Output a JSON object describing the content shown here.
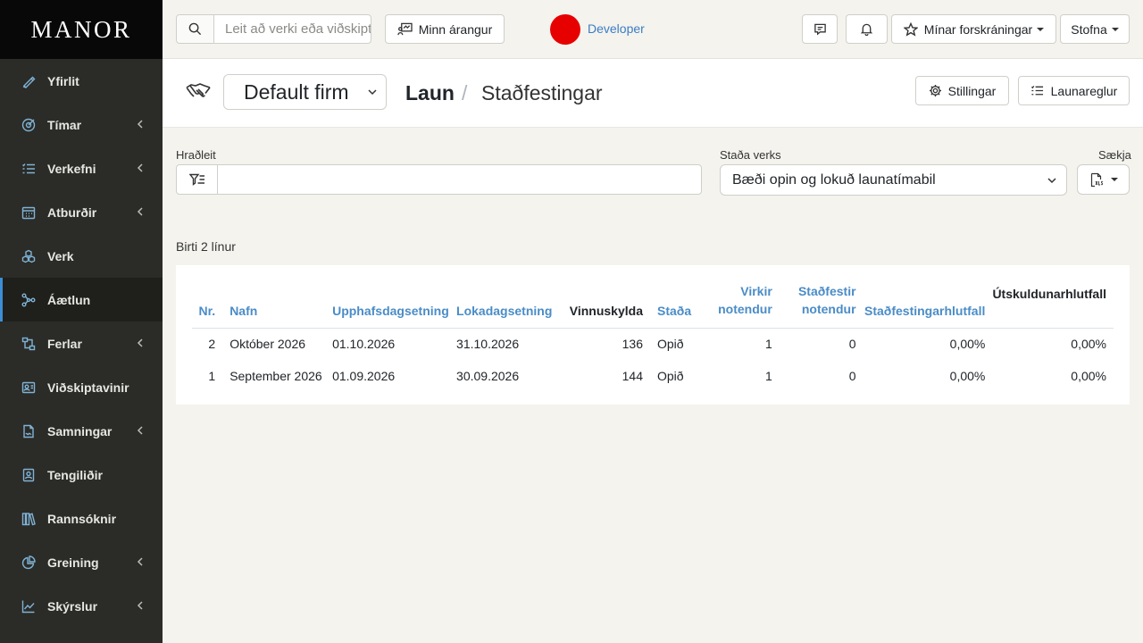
{
  "brand": "MANOR",
  "sidebar": {
    "items": [
      {
        "label": "Yfirlit",
        "icon": "pen-icon",
        "has_submenu": false
      },
      {
        "label": "Tímar",
        "icon": "target-clock-icon",
        "has_submenu": true
      },
      {
        "label": "Verkefni",
        "icon": "task-list-icon",
        "has_submenu": true
      },
      {
        "label": "Atburðir",
        "icon": "calendar-icon",
        "has_submenu": true
      },
      {
        "label": "Verk",
        "icon": "cubes-icon",
        "has_submenu": false
      },
      {
        "label": "Áætlun",
        "icon": "network-icon",
        "has_submenu": false,
        "active": true
      },
      {
        "label": "Ferlar",
        "icon": "process-icon",
        "has_submenu": true
      },
      {
        "label": "Viðskiptavinir",
        "icon": "id-card-icon",
        "has_submenu": false
      },
      {
        "label": "Samningar",
        "icon": "contract-icon",
        "has_submenu": true
      },
      {
        "label": "Tengiliðir",
        "icon": "contact-icon",
        "has_submenu": false
      },
      {
        "label": "Rannsóknir",
        "icon": "books-icon",
        "has_submenu": false
      },
      {
        "label": "Greining",
        "icon": "pie-chart-icon",
        "has_submenu": true
      },
      {
        "label": "Skýrslur",
        "icon": "line-chart-icon",
        "has_submenu": true
      }
    ]
  },
  "topbar": {
    "search_placeholder": "Leit að verki eða viðskiptavini",
    "achievements_label": "Minn árangur",
    "user_name": "Developer",
    "my_registrations_label": "Mínar forskráningar",
    "create_label": "Stofna"
  },
  "header": {
    "firm": "Default firm",
    "crumb_parent": "Laun",
    "crumb_separator": "/",
    "crumb_current": "Staðfestingar",
    "settings_label": "Stillingar",
    "rules_label": "Launareglur"
  },
  "filters": {
    "quick_search_label": "Hraðleit",
    "quick_search_value": "",
    "status_label": "Staða verks",
    "status_value": "Bæði opin og lokuð launatímabil",
    "fetch_label": "Sækja"
  },
  "table": {
    "row_count_text": "Birti 2 línur",
    "headers": {
      "nr": "Nr.",
      "name": "Nafn",
      "start": "Upphafsdagsetning",
      "end": "Lokadagsetning",
      "workload": "Vinnuskylda",
      "status": "Staða",
      "active_users_1": "Virkir",
      "active_users_2": "notendur",
      "confirmed_users_1": "Staðfestir",
      "confirmed_users_2": "notendur",
      "confirm_ratio": "Staðfestingarhlutfall",
      "payout_ratio": "Útskuldunarhlutfall"
    },
    "rows": [
      {
        "nr": "2",
        "name": "Október 2026",
        "start": "01.10.2026",
        "end": "31.10.2026",
        "workload": "136",
        "status": "Opið",
        "active_users": "1",
        "confirmed_users": "0",
        "confirm_ratio": "0,00%",
        "payout_ratio": "0,00%"
      },
      {
        "nr": "1",
        "name": "September 2026",
        "start": "01.09.2026",
        "end": "30.09.2026",
        "workload": "144",
        "status": "Opið",
        "active_users": "1",
        "confirmed_users": "0",
        "confirm_ratio": "0,00%",
        "payout_ratio": "0,00%"
      }
    ]
  },
  "colors": {
    "sidebar_bg": "#2b2b27",
    "brand_bg": "#080808",
    "accent_blue": "#4a8cc7",
    "active_indicator": "#3d8ed6",
    "avatar_red": "#e60000",
    "page_bg": "#f4f3ee"
  }
}
